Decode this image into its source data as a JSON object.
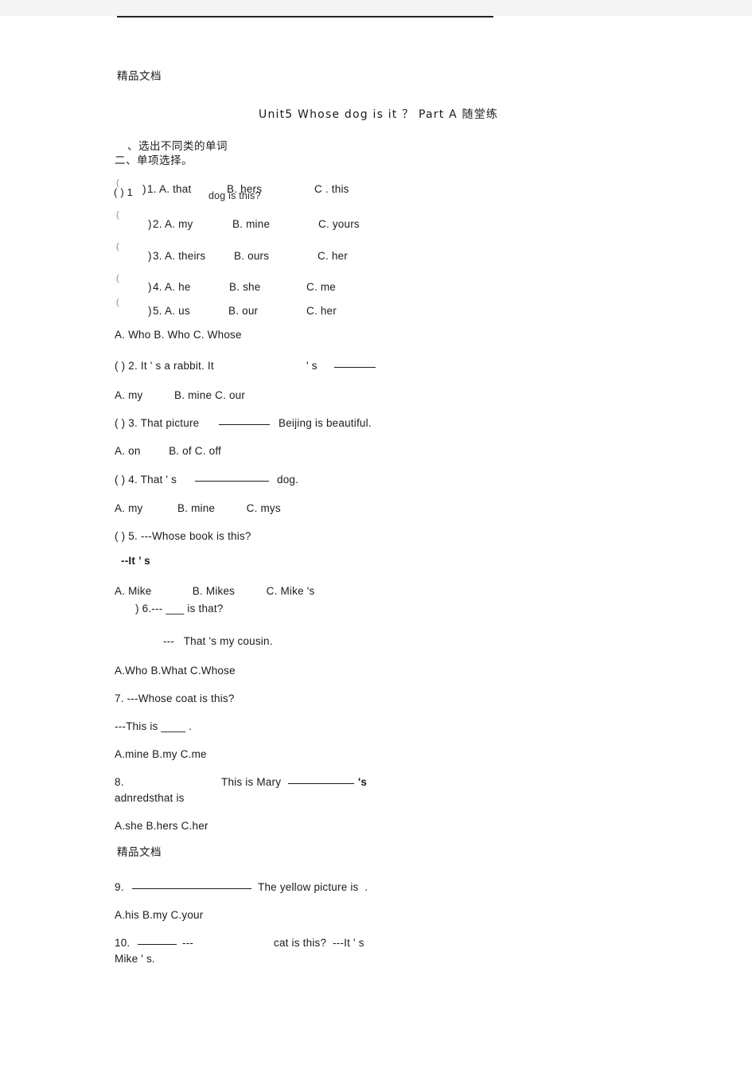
{
  "document": {
    "watermark_top": "精品文档",
    "watermark_mid": "精品文档",
    "title": "Unit5 Whose dog is it ？ Part A 随堂练",
    "section_one_heading": "、选出不同类的单词",
    "section_two_heading": "二、单项选择。"
  },
  "overlap": {
    "row1_marker": "( ) 1",
    "row1_ghost": "dog is this?"
  },
  "part_one": {
    "rows": [
      {
        "marker": ")",
        "num": "1.",
        "a": "A. that",
        "b": "B. hers",
        "c": "C . this"
      },
      {
        "marker": ")",
        "num": "2.",
        "a": "A. my",
        "b": "B. mine",
        "c": "C. yours"
      },
      {
        "marker": ")",
        "num": "3.",
        "a": "A. theirs",
        "b": "B. ours",
        "c": "C. her"
      },
      {
        "marker": ")",
        "num": "4.",
        "a": "A. he",
        "b": "B. she",
        "c": "C. me"
      },
      {
        "marker": ")",
        "num": "5.",
        "a": "A. us",
        "b": "B. our",
        "c": "C. her"
      }
    ]
  },
  "part_two": {
    "q1_options": "A. Who B. Who C. Whose",
    "q2_stem_a": "( ) 2. It ' s a rabbit. It",
    "q2_stem_b": "' s",
    "q2_options": "A. my          B. mine C. our",
    "q3_stem_a": "( ) 3. That picture",
    "q3_stem_b": "Beijing is beautiful.",
    "q3_options": "A. on         B. of C. off",
    "q4_stem_a": "( ) 4. That ' s",
    "q4_stem_b": "dog.",
    "q4_options": "A. my           B. mine          C. mys",
    "q5_stem": "( ) 5. ---Whose book is this?",
    "q5_answer": "--It ’ s",
    "q5_options": "A. Mike             B. Mikes          C. Mike 's",
    "q6_stem": ") 6.--- ___ is that?",
    "q6_answer": "---   That 's my cousin.",
    "q6_options": "A.Who B.What C.Whose",
    "q7_stem": "7. ---Whose coat is this?",
    "q7_answer": "---This is ____ .",
    "q7_options": "A.mine B.my C.me",
    "q8_num": "8.",
    "q8_stem": "This is Mary",
    "q8_tail": "'s",
    "q8_garble": "adnredsthat is",
    "q8_options": "A.she B.hers C.her",
    "q9_num": "9.",
    "q9_stem": "The yellow picture is  .",
    "q9_options": "A.his B.my C.your",
    "q10_num": "10.",
    "q10_dash": "---",
    "q10_stem": "cat is this?  ---It ' s",
    "q10_tail": "Mike ' s."
  }
}
